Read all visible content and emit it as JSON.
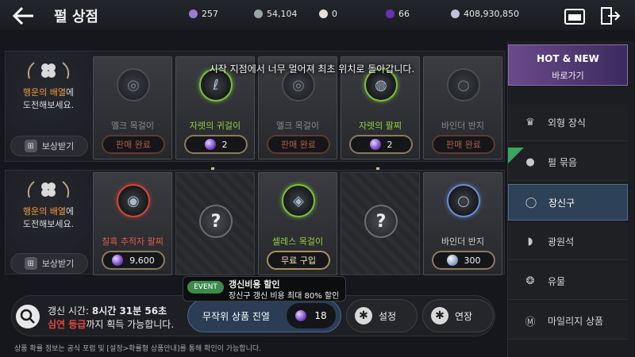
{
  "header": {
    "title": "펄 상점",
    "currencies": [
      {
        "icon": "purple-m-coin-icon",
        "value": "257",
        "color": "#9b7ad6"
      },
      {
        "icon": "silver-gem-icon",
        "value": "54,104",
        "color": "#9aa6a2"
      },
      {
        "icon": "pearl-icon",
        "value": "0",
        "color": "#e8ddd8"
      },
      {
        "icon": "purple-pearl-icon",
        "value": "66",
        "color": "#6b2fb5"
      },
      {
        "icon": "silver-coin-icon",
        "value": "408,930,850",
        "color": "#b9c6d8"
      }
    ]
  },
  "toast": "시작 지점에서 너무 멀어져 최초 위치로 돌아갑니다.",
  "rows": [
    {
      "event_text_hl": "행운의 배열",
      "event_text_rest": "에",
      "event_text_line2": "도전해보세요.",
      "reward_label": "보상받기",
      "cards": [
        {
          "name": "엘크 목걸이",
          "price": "판매 완료",
          "type": "sold"
        },
        {
          "name": "자렛의 귀걸이",
          "price": "2",
          "type": "gem"
        },
        {
          "name": "엘크 목걸이",
          "price": "판매 완료",
          "type": "sold"
        },
        {
          "name": "자렛의 팔찌",
          "price": "2",
          "type": "gem"
        },
        {
          "name": "바인더 반지",
          "price": "판매 완료",
          "type": "sold"
        }
      ]
    },
    {
      "event_text_hl": "행운의 배열",
      "event_text_rest": "에",
      "event_text_line2": "도전해보세요.",
      "reward_label": "보상받기",
      "cards": [
        {
          "name": "칠흑 추적자 팔찌",
          "price": "9,600",
          "type": "gem"
        },
        {
          "name": "?",
          "type": "mystery"
        },
        {
          "name": "셀레스 목걸이",
          "price": "무료 구입",
          "type": "free"
        },
        {
          "name": "?",
          "type": "mystery"
        },
        {
          "name": "바인더 반지",
          "price": "300",
          "type": "coin"
        }
      ]
    }
  ],
  "sidebar": {
    "hot_new": {
      "title": "HOT & NEW",
      "subtitle": "바로가기"
    },
    "items": [
      {
        "label": "외형 장식",
        "icon": "crown-icon"
      },
      {
        "label": "펄 묶음",
        "icon": "pearl-bundle-icon",
        "new": "NEW"
      },
      {
        "label": "장신구",
        "icon": "ring-icon",
        "active": true
      },
      {
        "label": "광원석",
        "icon": "crystal-icon"
      },
      {
        "label": "유물",
        "icon": "relic-icon"
      },
      {
        "label": "마일리지 상품",
        "icon": "mileage-icon"
      }
    ]
  },
  "bottom": {
    "refresh_prefix": "갱신 시간: ",
    "refresh_time": "8시간 31분 56초",
    "grade_red": "심연 등급",
    "grade_rest": "까지 획득 가능합니다.",
    "random_label": "무작위 상품 진열",
    "random_cost": "18",
    "settings_label": "설정",
    "extend_label": "연장",
    "event_badge": "EVENT",
    "event_title": "갱신비용 할인",
    "event_sub": "장신구 갱신 비용 최대 80% 할인",
    "footer": "상품 확률 정보는 공식 포럼 및 [설정>확률형 상품안내]를 통해 확인이 가능합니다."
  }
}
